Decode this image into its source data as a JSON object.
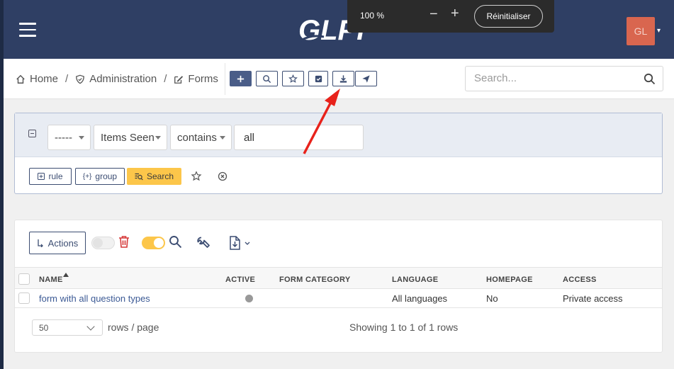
{
  "header": {
    "logo_text": "GLPI",
    "avatar_initials": "GL"
  },
  "zoom_popup": {
    "percent": "100 %",
    "minus": "−",
    "plus": "+",
    "reset_label": "Réinitialiser"
  },
  "breadcrumb": {
    "items": [
      "Home",
      "Administration",
      "Forms"
    ],
    "separator": "/"
  },
  "toolbar": {
    "icons": [
      "plus-icon",
      "search-icon",
      "star-icon",
      "check-square-icon",
      "download-icon",
      "send-icon"
    ]
  },
  "search": {
    "placeholder": "Search..."
  },
  "filter": {
    "criteria": {
      "link": "-----",
      "field": "Items Seen",
      "operator": "contains",
      "value": "all"
    },
    "buttons": {
      "rule": "rule",
      "group": "group",
      "search": "Search"
    }
  },
  "list": {
    "actions_label": "Actions",
    "columns": [
      "NAME",
      "ACTIVE",
      "FORM CATEGORY",
      "LANGUAGE",
      "HOMEPAGE",
      "ACCESS"
    ],
    "sorted_column": "NAME",
    "rows": [
      {
        "name": "form with all question types",
        "active": "",
        "form_category": "",
        "language": "All languages",
        "homepage": "No",
        "access": "Private access"
      }
    ],
    "pager": {
      "rows_per_page": "50",
      "rows_label": "rows / page",
      "showing": "Showing 1 to 1 of 1 rows"
    }
  },
  "colors": {
    "navbar": "#2f3f64",
    "accent": "#3c4d72",
    "search_button": "#fcc64a",
    "trash": "#d63939",
    "avatar": "#d9664f",
    "annotation_arrow": "#e8221b"
  }
}
